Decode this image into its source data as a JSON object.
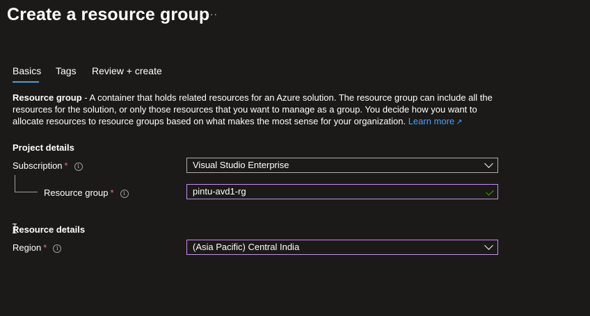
{
  "page": {
    "title": "Create a resource group",
    "more_label": "···"
  },
  "tabs": [
    {
      "label": "Basics",
      "selected": true
    },
    {
      "label": "Tags",
      "selected": false
    },
    {
      "label": "Review + create",
      "selected": false
    }
  ],
  "description": {
    "bold": "Resource group",
    "text": " - A container that holds related resources for an Azure solution. The resource group can include all the resources for the solution, or only those resources that you want to manage as a group. You decide how you want to allocate resources to resource groups based on what makes the most sense for your organization. ",
    "link": "Learn more"
  },
  "project_details": {
    "heading": "Project details",
    "subscription": {
      "label": "Subscription",
      "required": "*",
      "value": "Visual Studio Enterprise"
    },
    "resource_group": {
      "label": "Resource group",
      "required": "*",
      "value": "pintu-avd1-rg",
      "valid": true
    }
  },
  "resource_details": {
    "heading": "Resource details",
    "region": {
      "label": "Region",
      "required": "*",
      "value": "(Asia Pacific) Central India"
    }
  },
  "colors": {
    "background": "#1b1a19",
    "accent": "#4f9ee3",
    "link": "#4fa0f0",
    "required": "#f1707b",
    "focus_border": "#c58ff2",
    "valid": "#57a300"
  },
  "icons": [
    "more-icon",
    "info-icon",
    "chevron-down-icon",
    "checkmark-icon",
    "external-link-icon",
    "text-cursor-icon"
  ]
}
